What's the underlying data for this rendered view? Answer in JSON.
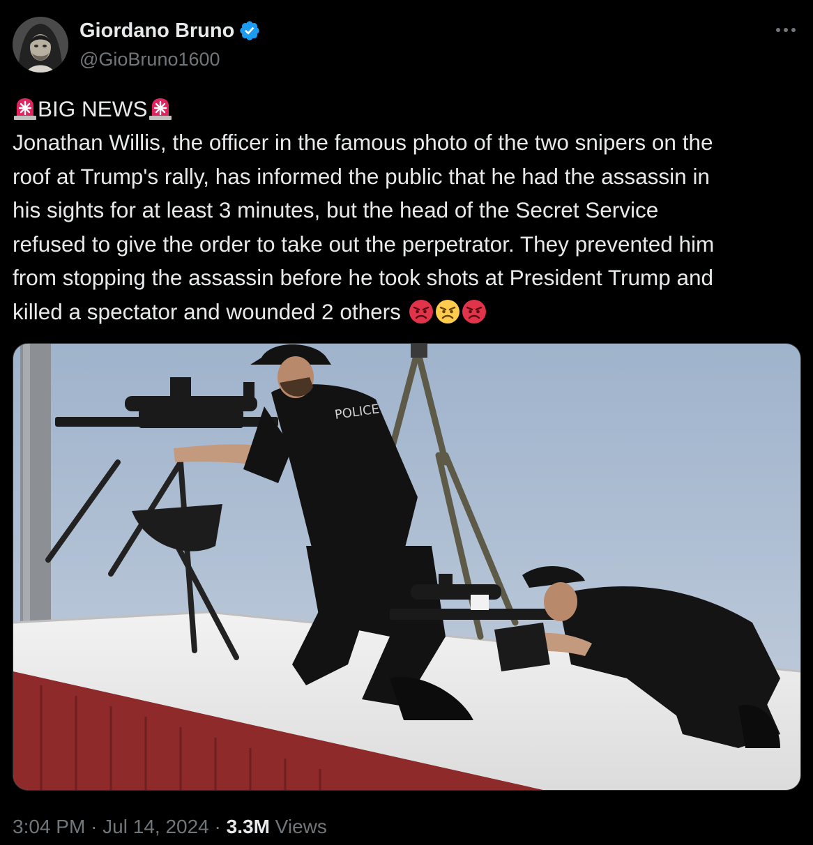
{
  "author": {
    "display_name": "Giordano Bruno",
    "handle": "@GioBruno1600",
    "verified": true
  },
  "tweet": {
    "headline": "BIG NEWS",
    "body_lines": [
      "Jonathan Willis, the officer in the famous photo of the two snipers on the",
      "roof at Trump's rally, has informed the public that he had the assassin in",
      "his sights for at least 3 minutes, but the head of the Secret Service",
      "refused to give the order to take out the perpetrator. They prevented him",
      "from stopping the assassin before he took shots at President Trump and",
      "killed a spectator and wounded 2 others"
    ],
    "emojis": [
      "angry-face",
      "angry-face-yellow",
      "angry-face"
    ],
    "media": {
      "vest_label": "POLICE"
    }
  },
  "meta": {
    "time": "3:04 PM",
    "separator": " · ",
    "date": "Jul 14, 2024",
    "views_count": "3.3M",
    "views_label": "Views"
  },
  "colors": {
    "background": "#000000",
    "text_primary": "#e7e9ea",
    "text_secondary": "#71767b",
    "verified_blue": "#1d9bf0",
    "siren_red": "#e0245e"
  }
}
